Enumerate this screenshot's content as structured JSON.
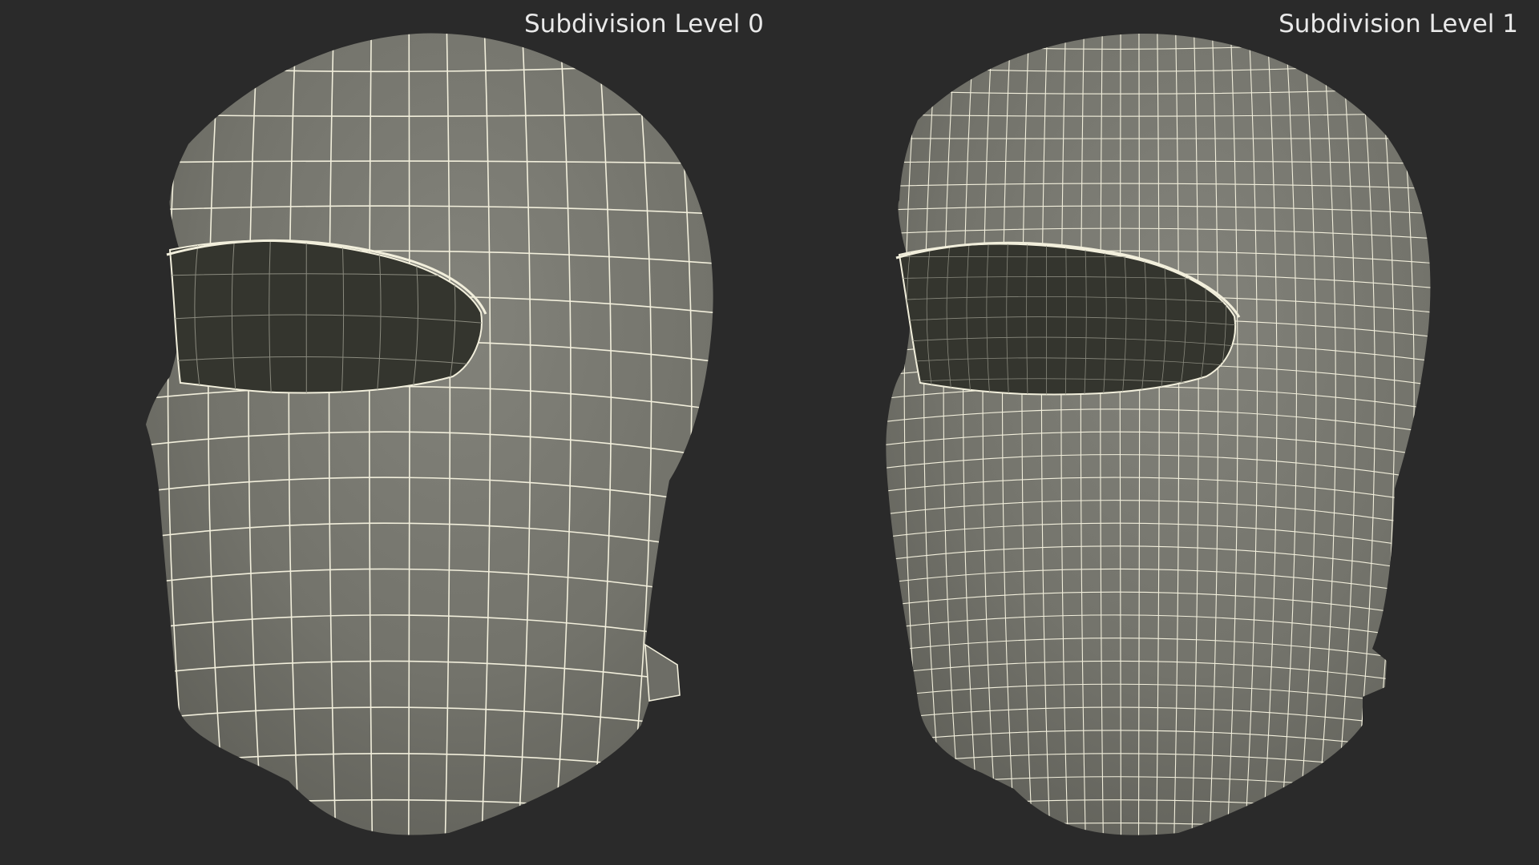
{
  "panels": [
    {
      "label": "Subdivision Level 0",
      "grid_density": 1
    },
    {
      "label": "Subdivision Level 1",
      "grid_density": 2
    }
  ],
  "colors": {
    "background": "#2a2a2a",
    "mesh_surface": "#777770",
    "mesh_shadow": "#5e5e57",
    "wireframe": "#f2efdc",
    "eye_opening": "#34352e",
    "label_text": "#e9e9e9"
  }
}
